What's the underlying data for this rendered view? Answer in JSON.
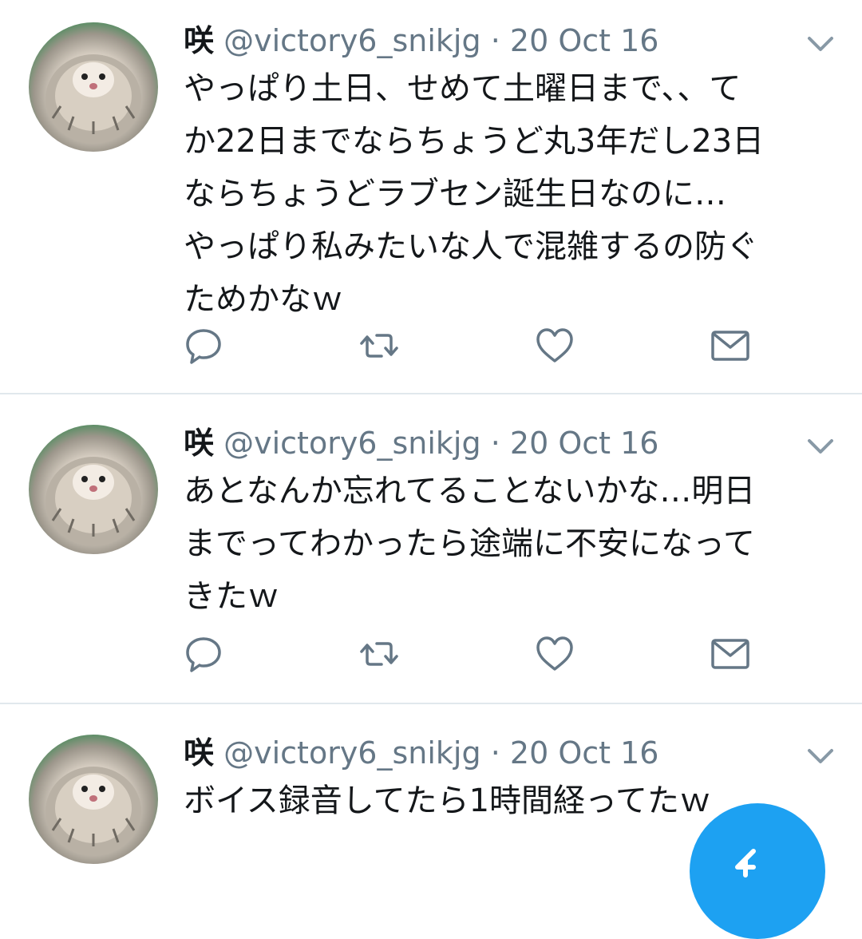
{
  "tweets": [
    {
      "name": "咲",
      "handle": "@victory6_snikjg",
      "separator": "·",
      "date": "20 Oct 16",
      "lines": [
        "やっぱり土日、せめて土曜日まで、、て",
        "か22日までならちょうど丸3年だし23日",
        "ならちょうどラブセン誕生日なのに…",
        "やっぱり私みたいな人で混雑するの防ぐ",
        "ためかなｗ"
      ]
    },
    {
      "name": "咲",
      "handle": "@victory6_snikjg",
      "separator": "·",
      "date": "20 Oct 16",
      "lines": [
        "あとなんか忘れてることないかな…明日",
        "までってわかったら途端に不安になって",
        "きたｗ"
      ]
    },
    {
      "name": "咲",
      "handle": "@victory6_snikjg",
      "separator": "·",
      "date": "20 Oct 16",
      "lines": [
        "ボイス録音してたら1時間経ってたｗ"
      ]
    }
  ],
  "icons": {
    "avatar": "hedgehog-avatar",
    "caret": "chevron-down-icon",
    "reply": "reply-icon",
    "retweet": "retweet-icon",
    "like": "heart-icon",
    "dm": "mail-icon",
    "compose": "compose-tweet-icon"
  },
  "colors": {
    "text": "#14171a",
    "secondary": "#657786",
    "divider": "#e1e8ed",
    "accent": "#1da1f2"
  }
}
